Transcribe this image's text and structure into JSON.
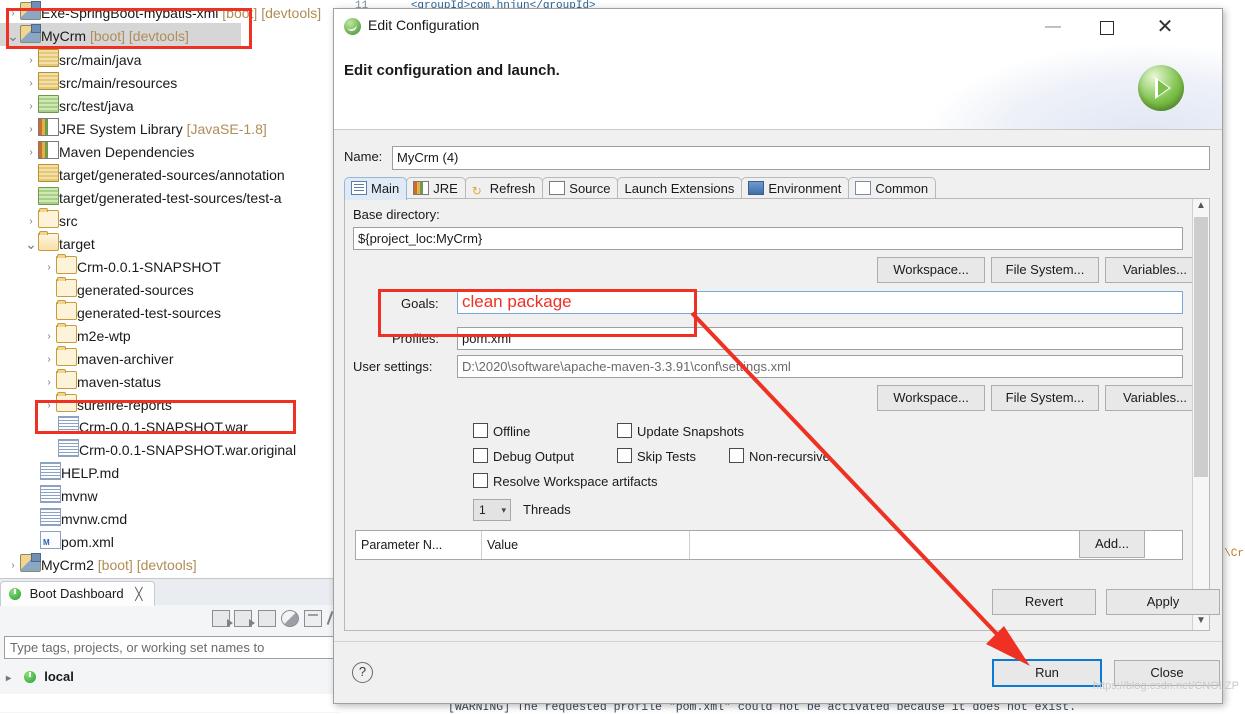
{
  "ide": {
    "editor_line": {
      "number": "11",
      "text": "<groupId>com.hnjun</groupId>"
    },
    "tree": [
      {
        "label": "Exe-SpringBoot-mybatis-xml",
        "suffix": "[boot] [devtools]",
        "icon": "boot-project-icon",
        "arrow": ">",
        "indent": 0,
        "selected": false
      },
      {
        "label": "MyCrm",
        "suffix": "[boot] [devtools]",
        "icon": "boot-project-icon",
        "arrow": "v",
        "indent": 0,
        "selected": true
      },
      {
        "label": "src/main/java",
        "suffix": "",
        "icon": "package-icon",
        "arrow": ">",
        "indent": 1,
        "selected": false
      },
      {
        "label": "src/main/resources",
        "suffix": "",
        "icon": "package-icon",
        "arrow": ">",
        "indent": 1,
        "selected": false
      },
      {
        "label": "src/test/java",
        "suffix": "",
        "icon": "package-green-icon",
        "arrow": ">",
        "indent": 1,
        "selected": false
      },
      {
        "label": "JRE System Library",
        "suffix": "[JavaSE-1.8]",
        "icon": "library-icon",
        "arrow": ">",
        "indent": 1,
        "selected": false
      },
      {
        "label": "Maven Dependencies",
        "suffix": "",
        "icon": "library-icon",
        "arrow": ">",
        "indent": 1,
        "selected": false
      },
      {
        "label": "target/generated-sources/annotation",
        "suffix": "",
        "icon": "package-icon",
        "arrow": "",
        "indent": 1,
        "selected": false
      },
      {
        "label": "target/generated-test-sources/test-a",
        "suffix": "",
        "icon": "package-green-icon",
        "arrow": "",
        "indent": 1,
        "selected": false
      },
      {
        "label": "src",
        "suffix": "",
        "icon": "folder-icon",
        "arrow": ">",
        "indent": 1,
        "selected": false
      },
      {
        "label": "target",
        "suffix": "",
        "icon": "folder-open-icon",
        "arrow": "v",
        "indent": 1,
        "selected": false
      },
      {
        "label": "Crm-0.0.1-SNAPSHOT",
        "suffix": "",
        "icon": "folder-icon",
        "arrow": ">",
        "indent": 2,
        "selected": false
      },
      {
        "label": "generated-sources",
        "suffix": "",
        "icon": "folder-icon",
        "arrow": "",
        "indent": 2,
        "selected": false
      },
      {
        "label": "generated-test-sources",
        "suffix": "",
        "icon": "folder-icon",
        "arrow": "",
        "indent": 2,
        "selected": false
      },
      {
        "label": "m2e-wtp",
        "suffix": "",
        "icon": "folder-icon",
        "arrow": ">",
        "indent": 2,
        "selected": false
      },
      {
        "label": "maven-archiver",
        "suffix": "",
        "icon": "folder-icon",
        "arrow": ">",
        "indent": 2,
        "selected": false
      },
      {
        "label": "maven-status",
        "suffix": "",
        "icon": "folder-icon",
        "arrow": ">",
        "indent": 2,
        "selected": false
      },
      {
        "label": "surefire-reports",
        "suffix": "",
        "icon": "folder-icon",
        "arrow": ">",
        "indent": 2,
        "selected": false
      },
      {
        "label": "Crm-0.0.1-SNAPSHOT.war",
        "suffix": "",
        "icon": "file-icon",
        "arrow": "",
        "indent": 2,
        "selected": false
      },
      {
        "label": "Crm-0.0.1-SNAPSHOT.war.original",
        "suffix": "",
        "icon": "file-icon",
        "arrow": "",
        "indent": 2,
        "selected": false
      },
      {
        "label": "HELP.md",
        "suffix": "",
        "icon": "file-icon",
        "arrow": "",
        "indent": 1,
        "selected": false
      },
      {
        "label": "mvnw",
        "suffix": "",
        "icon": "file-icon",
        "arrow": "",
        "indent": 1,
        "selected": false
      },
      {
        "label": "mvnw.cmd",
        "suffix": "",
        "icon": "file-icon",
        "arrow": "",
        "indent": 1,
        "selected": false
      },
      {
        "label": "pom.xml",
        "suffix": "",
        "icon": "xml-file-icon",
        "arrow": "",
        "indent": 1,
        "selected": false
      },
      {
        "label": "MyCrm2",
        "suffix": "[boot] [devtools]",
        "icon": "boot-project-icon",
        "arrow": ">",
        "indent": 0,
        "selected": false
      }
    ],
    "boot_dashboard": {
      "tab_label": "Boot Dashboard",
      "close_glyph": "╳",
      "filter_placeholder": "Type tags, projects, or working set names to",
      "local_label": "local",
      "toolbar_icons": [
        "start-icon",
        "debug-icon",
        "stop-icon",
        "open-browser-icon",
        "open-console-icon",
        "edit-icon"
      ]
    },
    "console_warning": "[WARNING] The requested profile \"pom.xml\" could not be activated because it does not exist.",
    "right_fragment": "\\Cr",
    "watermark": "https://blog.csdn.net/CNOLZP"
  },
  "dialog": {
    "window_title": "Edit Configuration",
    "heading": "Edit configuration and launch.",
    "window_controls": {
      "minimize": "—",
      "maximize": "",
      "close": "✕"
    },
    "name": {
      "label": "Name:",
      "value": "MyCrm (4)"
    },
    "tabs": [
      {
        "label": "Main",
        "icon": "main-tab-icon",
        "active": true
      },
      {
        "label": "JRE",
        "icon": "jre-tab-icon",
        "active": false
      },
      {
        "label": "Refresh",
        "icon": "refresh-tab-icon",
        "active": false
      },
      {
        "label": "Source",
        "icon": "source-tab-icon",
        "active": false
      },
      {
        "label": "Launch Extensions",
        "icon": "",
        "active": false
      },
      {
        "label": "Environment",
        "icon": "environment-tab-icon",
        "active": false
      },
      {
        "label": "Common",
        "icon": "common-tab-icon",
        "active": false
      }
    ],
    "main_tab": {
      "base_directory_label": "Base directory:",
      "base_directory_value": "${project_loc:MyCrm}",
      "browse_buttons_top": [
        "Workspace...",
        "File System...",
        "Variables..."
      ],
      "goals_label": "Goals:",
      "goals_value": "clean package",
      "profiles_label": "Profiles:",
      "profiles_value": "pom.xml",
      "user_settings_label": "User settings:",
      "user_settings_value": "D:\\2020\\software\\apache-maven-3.3.91\\conf\\settings.xml",
      "browse_buttons_bottom": [
        "Workspace...",
        "File System...",
        "Variables..."
      ],
      "checkboxes": [
        {
          "label": "Offline",
          "checked": false
        },
        {
          "label": "Update Snapshots",
          "checked": false
        },
        {
          "label": "Debug Output",
          "checked": false
        },
        {
          "label": "Skip Tests",
          "checked": false
        },
        {
          "label": "Non-recursive",
          "checked": false
        },
        {
          "label": "Resolve Workspace artifacts",
          "checked": false
        }
      ],
      "threads_value": "1",
      "threads_label": "Threads",
      "param_table": {
        "col_name": "Parameter N...",
        "col_value": "Value"
      },
      "add_button": "Add..."
    },
    "buttons": {
      "revert": "Revert",
      "apply": "Apply",
      "run": "Run",
      "close": "Close",
      "help": "?"
    }
  },
  "colors": {
    "annotation_red": "#ef3124",
    "focus_blue": "#0a7ad4",
    "accent_green": "#3f8f2e"
  }
}
